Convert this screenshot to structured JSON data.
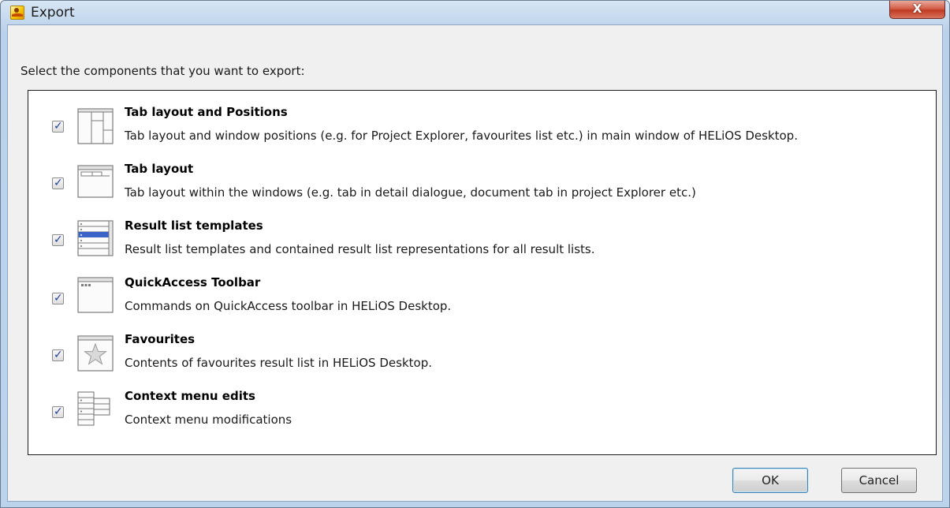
{
  "window": {
    "title": "Export",
    "close_glyph": "X"
  },
  "instruction": "Select the components that you want to export:",
  "items": [
    {
      "checked": true,
      "icon": "tab-layout-positions-icon",
      "title": "Tab layout and Positions",
      "description": "Tab layout and window positions (e.g. for Project Explorer, favourites list etc.) in main window of HELiOS Desktop."
    },
    {
      "checked": true,
      "icon": "tab-layout-icon",
      "title": "Tab layout",
      "description": "Tab layout within the windows (e.g. tab in detail dialogue, document tab in project Explorer etc.)"
    },
    {
      "checked": true,
      "icon": "result-list-icon",
      "title": "Result list templates",
      "description": "Result list templates and contained result list representations for all result lists."
    },
    {
      "checked": true,
      "icon": "toolbar-window-icon",
      "title": "QuickAccess Toolbar",
      "description": "Commands on QuickAccess toolbar in HELiOS Desktop."
    },
    {
      "checked": true,
      "icon": "star-icon",
      "title": "Favourites",
      "description": "Contents of favourites result list in HELiOS Desktop."
    },
    {
      "checked": true,
      "icon": "context-menu-icon",
      "title": "Context menu edits",
      "description": "Context menu modifications"
    }
  ],
  "check_glyph": "✓",
  "buttons": {
    "ok": "OK",
    "cancel": "Cancel"
  }
}
